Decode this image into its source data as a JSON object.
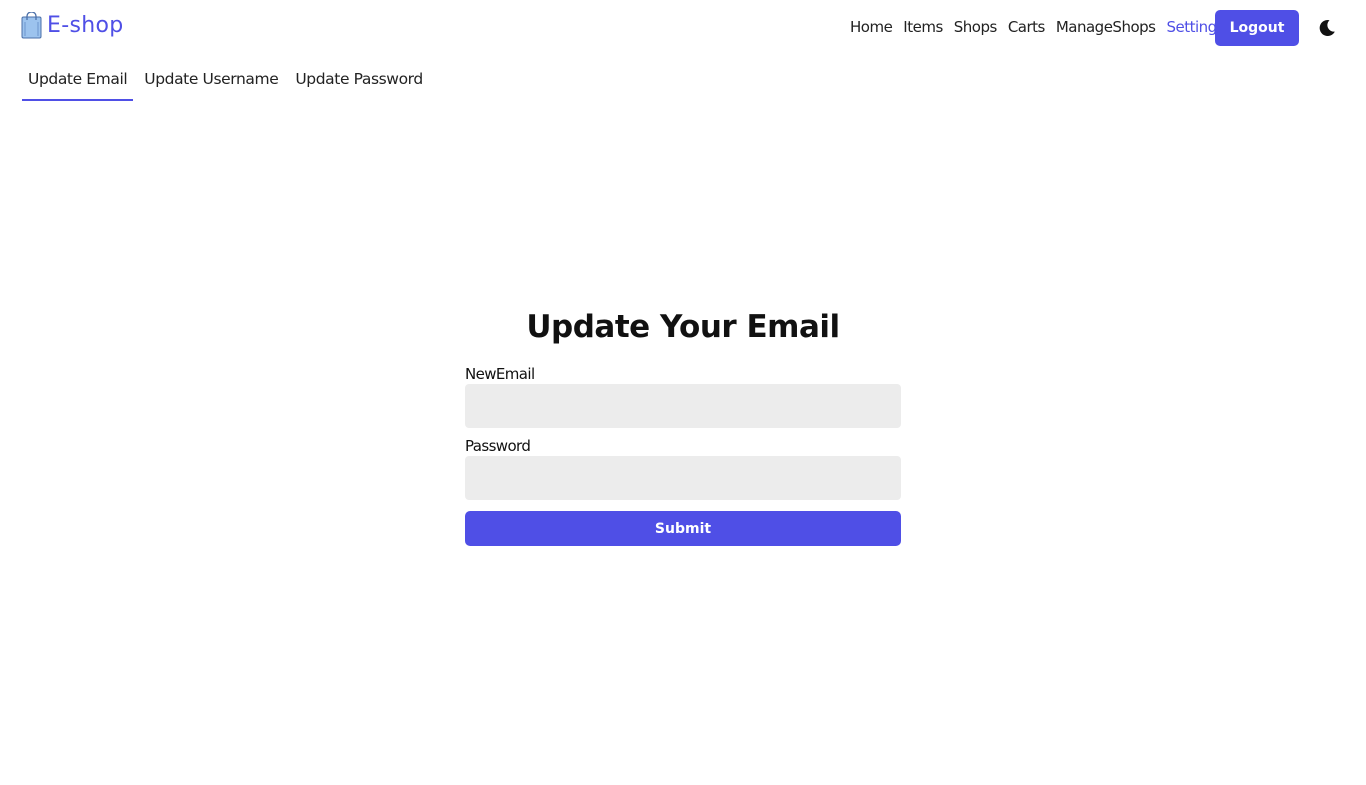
{
  "brand": {
    "name": "E-shop",
    "icon": "shopping-bag-icon",
    "color": "#4f4fe6"
  },
  "nav": {
    "links": [
      {
        "label": "Home",
        "active": false
      },
      {
        "label": "Items",
        "active": false
      },
      {
        "label": "Shops",
        "active": false
      },
      {
        "label": "Carts",
        "active": false
      },
      {
        "label": "ManageShops",
        "active": false
      },
      {
        "label": "Settings",
        "active": true
      }
    ],
    "logout_label": "Logout",
    "theme_icon": "moon-icon"
  },
  "tabs": [
    {
      "label": "Update Email",
      "active": true
    },
    {
      "label": "Update Username",
      "active": false
    },
    {
      "label": "Update Password",
      "active": false
    }
  ],
  "form": {
    "title": "Update Your Email",
    "new_email_label": "NewEmail",
    "new_email_value": "",
    "password_label": "Password",
    "password_value": "",
    "submit_label": "Submit"
  },
  "colors": {
    "accent": "#4f4fe6",
    "input_bg": "#ececec"
  }
}
